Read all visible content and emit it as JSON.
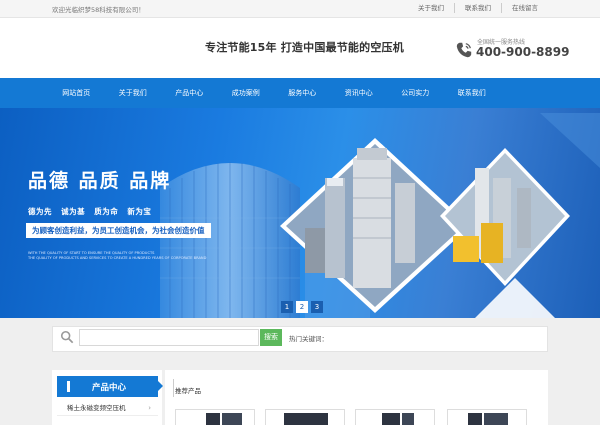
{
  "topbar": {
    "welcome": "欢迎光临织梦58科技有限公司！",
    "links": [
      "关于我们",
      "联系我们",
      "在线留言"
    ]
  },
  "header": {
    "slogan": "专注节能15年  打造中国最节能的空压机",
    "hotline_label": "全国统一服务热线",
    "hotline_number": "400-900-8899",
    "icon": "phone-icon"
  },
  "nav": {
    "items": [
      "网站首页",
      "关于我们",
      "产品中心",
      "成功案例",
      "服务中心",
      "资讯中心",
      "公司实力",
      "联系我们"
    ]
  },
  "banner": {
    "title": "品德  品质  品牌",
    "tags": [
      "德为先",
      "诚为基",
      "质为命",
      "新为宝"
    ],
    "strip": "为顾客创造利益，为员工创造机会，为社会创造价值",
    "english": [
      "WITH THE QUALITY OF START TO ENSURE THE QUALITY OF PRODUCTS",
      "THE QUALITY OF PRODUCTS AND SERVICES TO CREATE A HUNDRED YEARS OF CORPORATE BRAND"
    ],
    "pages": [
      "1",
      "2",
      "3"
    ],
    "active_page": "1"
  },
  "search": {
    "placeholder": "",
    "button": "搜索",
    "hot_label": "热门关键词："
  },
  "sidebar": {
    "title": "产品中心",
    "items": [
      {
        "label": "稀土永磁变频空压机"
      }
    ]
  },
  "main": {
    "section_title": "推荐产品"
  },
  "colors": {
    "primary": "#1479d4",
    "search_button": "#5cb85c"
  }
}
